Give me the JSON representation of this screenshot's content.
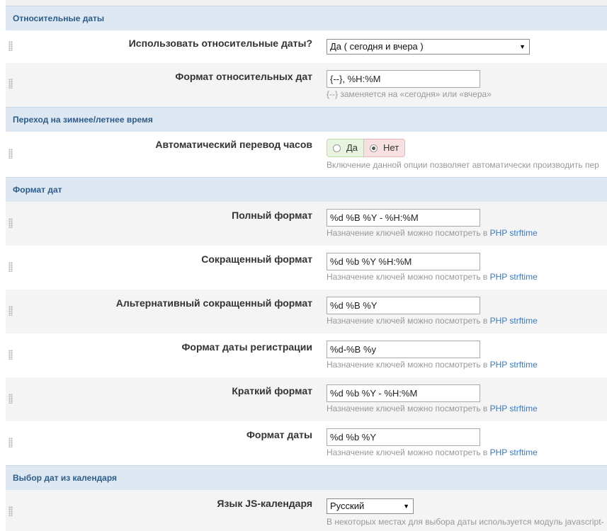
{
  "sections": {
    "relative": "Относительные даты",
    "dst": "Переход на зимнее/летнее время",
    "formats": "Формат дат",
    "calendar": "Выбор дат из календаря"
  },
  "relative": {
    "use_label": "Использовать относительные даты?",
    "use_value": "Да ( сегодня и вчера )",
    "format_label": "Формат относительных дат",
    "format_value": "{--}, %H:%M",
    "format_hint": "{--} заменяется на «сегодня» или «вчера»"
  },
  "dst": {
    "label": "Автоматический перевод часов",
    "yes": "Да",
    "no": "Нет",
    "selected": "Нет",
    "hint": "Включение данной опции позволяет автоматически производить пер"
  },
  "hint_common": "Назначение ключей можно посмотреть в ",
  "hint_link": "PHP strftime",
  "formats": [
    {
      "label": "Полный формат",
      "value": "%d %B %Y - %H:%M"
    },
    {
      "label": "Сокращенный формат",
      "value": "%d %b %Y %H:%M"
    },
    {
      "label": "Альтернативный сокращенный формат",
      "value": "%d %B %Y"
    },
    {
      "label": "Формат даты регистрации",
      "value": "%d-%B %y"
    },
    {
      "label": "Краткий формат",
      "value": "%d %b %Y - %H:%M"
    },
    {
      "label": "Формат даты",
      "value": "%d %b %Y"
    }
  ],
  "calendar": {
    "lang_label": "Язык JS-календаря",
    "lang_value": "Русский",
    "hint": "В некоторых местах для выбора даты используется модуль javascript-"
  },
  "icons": {
    "drag": "drag-handle-icon",
    "dropdown": "chevron-down-icon"
  }
}
